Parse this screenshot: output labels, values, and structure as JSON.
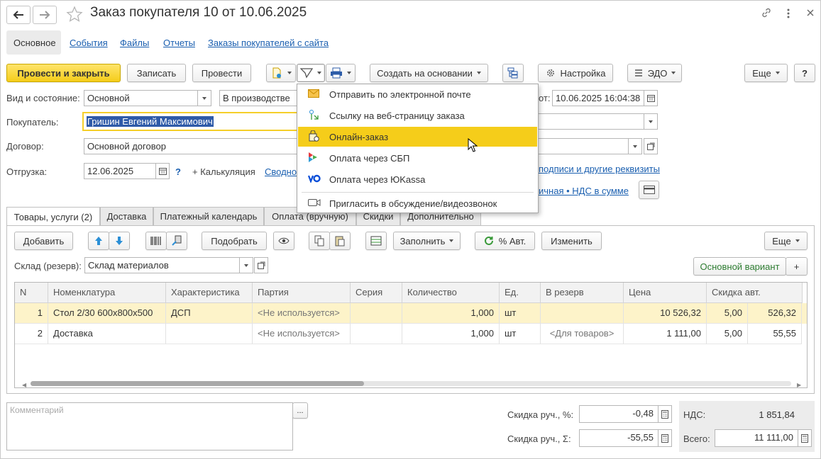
{
  "header": {
    "title": "Заказ покупателя 10 от 10.06.2025",
    "nav_back": "←",
    "nav_forward": "→"
  },
  "sections": [
    "Основное",
    "События",
    "Файлы",
    "Отчеты",
    "Заказы покупателей с сайта"
  ],
  "toolbar": {
    "post_close": "Провести и закрыть",
    "write": "Записать",
    "post": "Провести",
    "create_basis": "Создать на основании",
    "settings": "Настройка",
    "edo": "ЭДО",
    "more": "Еще",
    "help": "?"
  },
  "form": {
    "state_label": "Вид и состояние:",
    "state_kind": "Основной",
    "state_status": "В производстве",
    "date_label_tail": "от:",
    "date_value": "10.06.2025 16:04:38",
    "customer_label": "Покупатель:",
    "customer_value": "Гришин Евгений Максимович",
    "contract_label": "Договор:",
    "contract_value": "Основной договор",
    "shipment_label": "Отгрузка:",
    "shipment_date": "12.06.2025",
    "shipment_help": "?",
    "calc_link": "+ Калькуляция",
    "summary_link": "Сводно",
    "signatures_link": "подписи и другие реквизиты",
    "vat_link": "ичная • НДС в сумме"
  },
  "popup_menu": {
    "items": [
      {
        "label": "Отправить по электронной почте",
        "icon": "envelope-icon"
      },
      {
        "label": "Ссылку на веб-страницу заказа",
        "icon": "web-link-icon"
      },
      {
        "label": "Онлайн-заказ",
        "icon": "shopping-bag-icon",
        "highlighted": true
      },
      {
        "label": "Оплата через СБП",
        "icon": "sbp-icon"
      },
      {
        "label": "Оплата через ЮKassa",
        "icon": "yookassa-icon"
      },
      {
        "label": "Пригласить в обсуждение/видеозвонок",
        "icon": "video-call-icon"
      }
    ]
  },
  "tabs": [
    "Товары, услуги (2)",
    "Доставка",
    "Платежный календарь",
    "Оплата (вручную)",
    "Скидки",
    "Дополнительно"
  ],
  "table_toolbar": {
    "add": "Добавить",
    "pick": "Подобрать",
    "fill": "Заполнить",
    "auto_percent": "% Авт.",
    "change": "Изменить",
    "more": "Еще"
  },
  "warehouse": {
    "label": "Склад (резерв):",
    "value": "Склад материалов",
    "variant": "Основной вариант",
    "plus": "+"
  },
  "table": {
    "columns": [
      "N",
      "Номенклатура",
      "Характеристика",
      "Партия",
      "Серия",
      "Количество",
      "Ед.",
      "В резерв",
      "Цена",
      "Скидка авт."
    ],
    "rows": [
      {
        "n": "1",
        "item": "Стол 2/30 600х800х500",
        "char": "ДСП",
        "batch": "<Не используется>",
        "series": "",
        "qty": "1,000",
        "unit": "шт",
        "reserve": "",
        "price": "10 526,32",
        "disc_pct": "5,00",
        "disc_sum": "526,32"
      },
      {
        "n": "2",
        "item": "Доставка",
        "char": "",
        "batch": "<Не используется>",
        "series": "",
        "qty": "1,000",
        "unit": "шт",
        "reserve": "<Для товаров>",
        "price": "1 111,00",
        "disc_pct": "5,00",
        "disc_sum": "55,55"
      }
    ]
  },
  "footer": {
    "comment_placeholder": "Комментарий",
    "comment_btn": "...",
    "manual_disc_pct_label": "Скидка руч., %:",
    "manual_disc_pct": "-0,48",
    "manual_disc_sum_label": "Скидка руч., Σ:",
    "manual_disc_sum": "-55,55",
    "vat_label": "НДС:",
    "vat_value": "1 851,84",
    "total_label": "Всего:",
    "total_value": "11 111,00"
  },
  "colors": {
    "accent_yellow": "#f5cd1a",
    "link_blue": "#1a5fb0",
    "selected_row": "#fdf3c9"
  }
}
